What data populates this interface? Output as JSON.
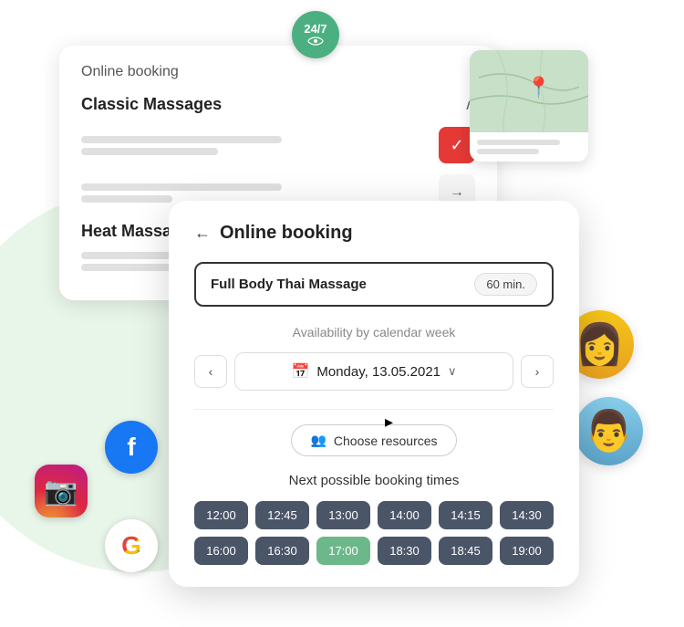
{
  "app": {
    "title": "Online booking",
    "badge_247": "24/7"
  },
  "back_card": {
    "title": "Online booking",
    "section1": {
      "name": "Classic Massages",
      "chevron": "∧"
    },
    "section2": {
      "name": "Heat Massages"
    }
  },
  "modal": {
    "back_label": "←",
    "title": "Online booking",
    "service": {
      "name": "Full Body Thai Massage",
      "duration": "60 min."
    },
    "availability_label": "Availability by calendar week",
    "date": "Monday, 13.05.2021",
    "nav_prev": "‹",
    "nav_next": "›",
    "choose_resources": "Choose resources",
    "next_booking_label": "Next possible booking times",
    "time_slots": [
      {
        "time": "12:00",
        "active": false
      },
      {
        "time": "12:45",
        "active": false
      },
      {
        "time": "13:00",
        "active": false
      },
      {
        "time": "14:00",
        "active": false
      },
      {
        "time": "14:15",
        "active": false
      },
      {
        "time": "14:30",
        "active": false
      },
      {
        "time": "16:00",
        "active": false
      },
      {
        "time": "16:30",
        "active": false
      },
      {
        "time": "17:00",
        "active": true
      },
      {
        "time": "18:30",
        "active": false
      },
      {
        "time": "18:45",
        "active": false
      },
      {
        "time": "19:00",
        "active": false
      }
    ]
  },
  "social": {
    "facebook": "f",
    "instagram": "📷",
    "google": "G"
  }
}
